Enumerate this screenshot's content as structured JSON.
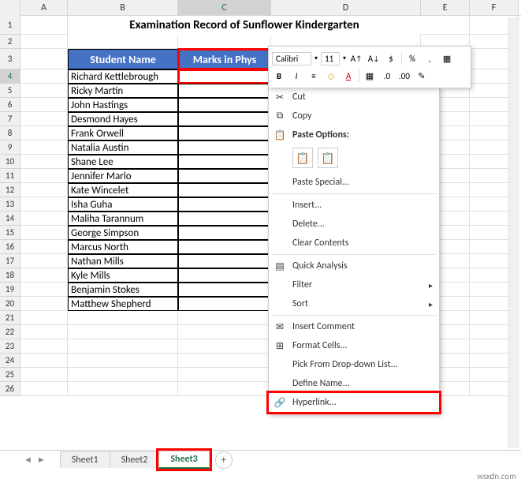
{
  "columns": [
    "A",
    "B",
    "C",
    "D",
    "E",
    "F"
  ],
  "rows_visible": 26,
  "title": "Examination Record of Sunflower Kindergarten",
  "headers": {
    "b": "Student Name",
    "c": "Marks in Phys"
  },
  "students": [
    "Richard Kettlebrough",
    "Ricky Martin",
    "John Hastings",
    "Desmond Hayes",
    "Frank Orwell",
    "Natalia Austin",
    "Shane Lee",
    "Jennifer Marlo",
    "Kate Wincelet",
    "Isha Guha",
    "Maliha Tarannum",
    "George Simpson",
    "Marcus North",
    "Nathan Mills",
    "Kyle Mills",
    "Benjamin Stokes",
    "Matthew Shepherd"
  ],
  "active_cell": "C4",
  "mini_toolbar": {
    "font": "Calibri",
    "size": "11",
    "btns_row1": [
      "A↑",
      "A↓",
      "$",
      "%",
      ","
    ],
    "btns_row2": [
      "B",
      "I",
      "≣",
      "◇",
      "A",
      "▦",
      "▾",
      "◦"
    ]
  },
  "context_menu": {
    "cut": "Cut",
    "copy": "Copy",
    "paste_options": "Paste Options:",
    "paste_special": "Paste Special...",
    "insert": "Insert...",
    "delete": "Delete...",
    "clear": "Clear Contents",
    "quick": "Quick Analysis",
    "filter": "Filter",
    "sort": "Sort",
    "comment": "Insert Comment",
    "format": "Format Cells...",
    "dropdown": "Pick From Drop-down List...",
    "define": "Define Name...",
    "hyperlink": "Hyperlink..."
  },
  "tabs": [
    "Sheet1",
    "Sheet2",
    "Sheet3"
  ],
  "active_tab": "Sheet3",
  "watermark": "wsxdn.com"
}
